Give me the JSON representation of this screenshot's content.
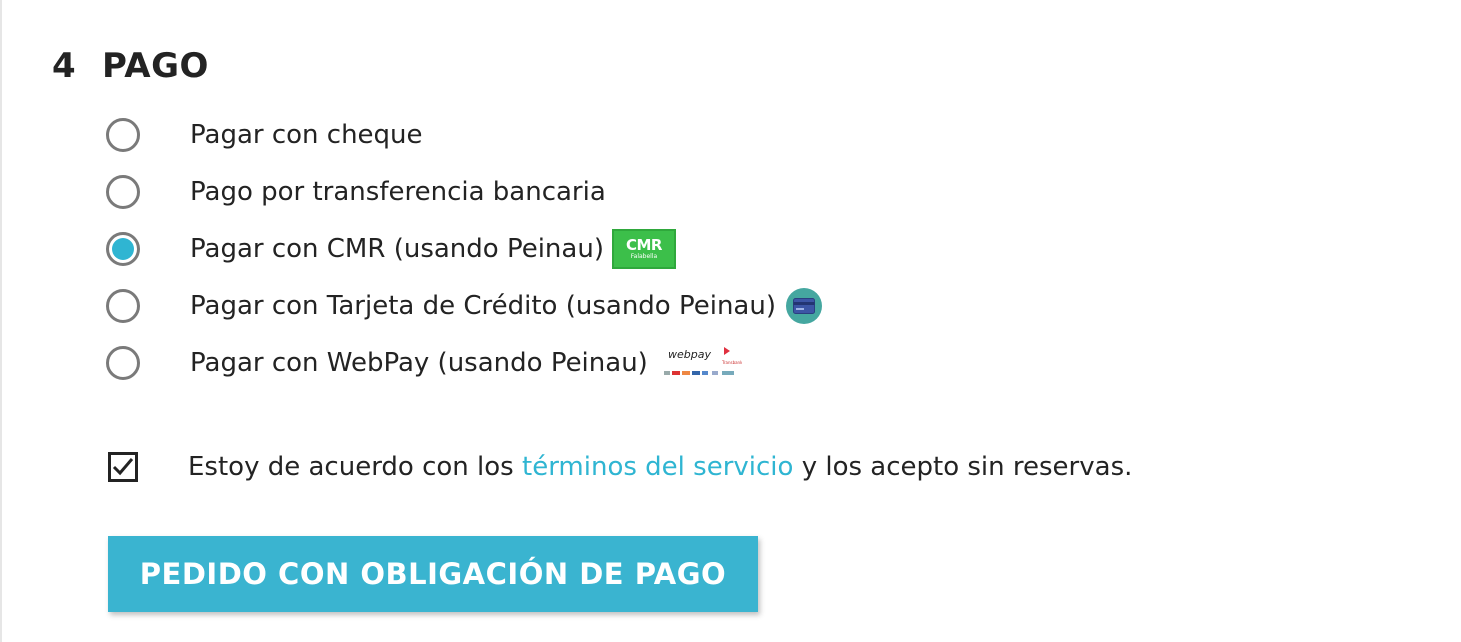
{
  "step": {
    "number": "4",
    "title": "PAGO"
  },
  "payment_options": [
    {
      "label": "Pagar con cheque",
      "selected": false
    },
    {
      "label": "Pago por transferencia bancaria",
      "selected": false
    },
    {
      "label": "Pagar con CMR (usando Peinau)",
      "selected": true,
      "logo": "cmr-falabella-logo"
    },
    {
      "label": "Pagar con Tarjeta de Crédito (usando Peinau)",
      "selected": false,
      "logo": "credit-card-icon"
    },
    {
      "label": "Pagar con WebPay (usando Peinau)",
      "selected": false,
      "logo": "webpay-logo"
    }
  ],
  "logos": {
    "cmr_main": "CMR",
    "cmr_sub": "Falabella",
    "webpay": "webpay"
  },
  "terms": {
    "checked": true,
    "prefix": "Estoy de acuerdo con los ",
    "link": "términos del servicio",
    "suffix": " y los acepto sin reservas."
  },
  "submit": {
    "label": "PEDIDO CON OBLIGACIÓN DE PAGO"
  },
  "colors": {
    "accent": "#2fb5d2",
    "button": "#3ab4d0",
    "cmr_green": "#3cbf4a"
  }
}
